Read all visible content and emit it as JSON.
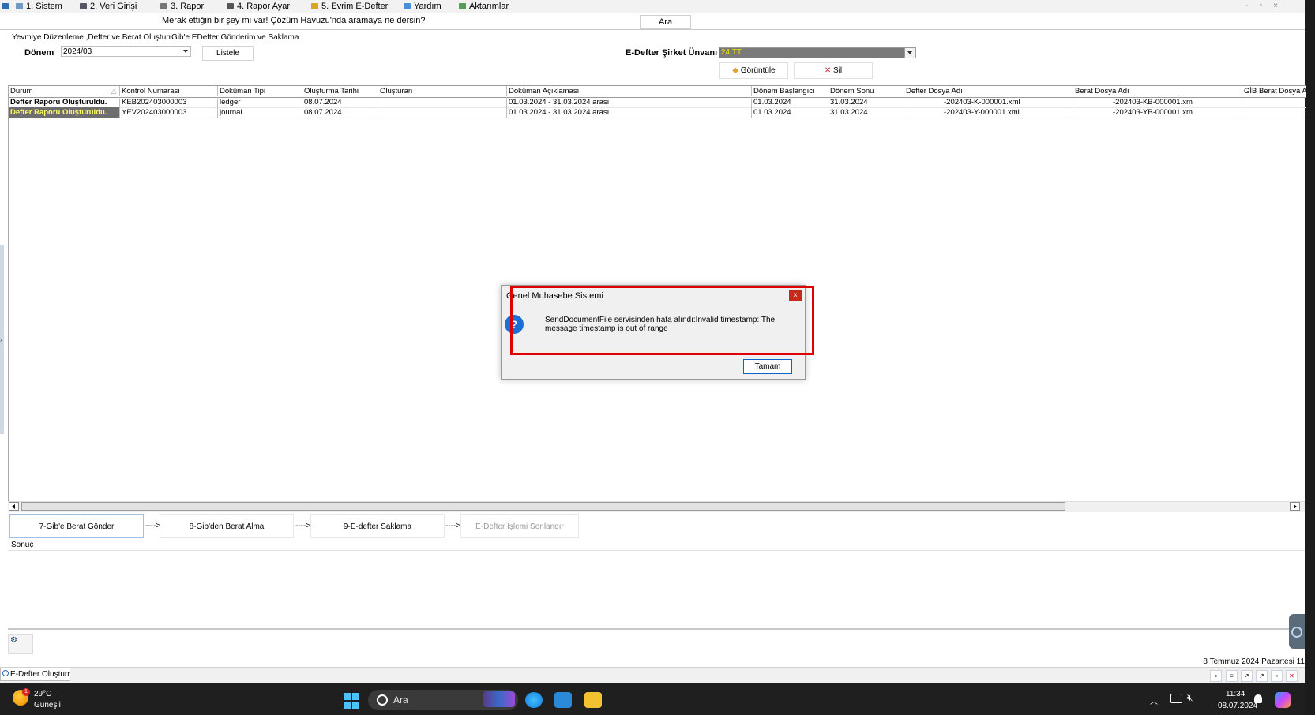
{
  "menu": {
    "items": [
      {
        "label": "1. Sistem"
      },
      {
        "label": "2.   Veri Girişi"
      },
      {
        "label": "3.   Rapor"
      },
      {
        "label": "4.   Rapor Ayar"
      },
      {
        "label": "5. Evrim E-Defter"
      },
      {
        "label": "Yardım"
      },
      {
        "label": "Aktarımlar"
      }
    ]
  },
  "search": {
    "prompt": "Merak ettiğin bir şey mi var! Çözüm Havuzu'nda aramaya ne dersin?",
    "button_label": "Ara"
  },
  "tabs": [
    {
      "label": "Yevmiye Düzenleme ,Defter ve Berat Oluşturma"
    },
    {
      "label": "Gib'e EDefter Gönderim ve Saklama"
    }
  ],
  "filters": {
    "donem_label": "Dönem",
    "donem_value": "2024/03",
    "listele_label": "Listele",
    "unvan_label": "E-Defter Şirket Ünvanı",
    "unvan_value": "24:TT",
    "goruntule_label": "Görüntüle",
    "sil_label": "Sil"
  },
  "grid": {
    "columns": [
      {
        "label": "Durum"
      },
      {
        "label": "Kontrol Numarası"
      },
      {
        "label": "Doküman Tipi"
      },
      {
        "label": "Oluşturma Tarihi"
      },
      {
        "label": "Oluşturan"
      },
      {
        "label": "Doküman Açıklaması"
      },
      {
        "label": "Dönem Başlangıcı"
      },
      {
        "label": "Dönem Sonu"
      },
      {
        "label": "Defter Dosya Adı"
      },
      {
        "label": "Berat Dosya Adı"
      },
      {
        "label": "GİB Berat Dosya A"
      }
    ],
    "rows": [
      {
        "durum": "Defter Raporu Oluşturuldu.",
        "kontrol": "KEB202403000003",
        "tip": "ledger",
        "tarih": "08.07.2024",
        "olusturan": "",
        "aciklama": "01.03.2024 - 31.03.2024 arası",
        "baslangic": "01.03.2024",
        "sonu": "31.03.2024",
        "defter_dosya": "-202403-K-000001.xml",
        "berat_dosya": "-202403-KB-000001.xm",
        "gib_berat": ""
      },
      {
        "durum": "Defter Raporu Oluşturuldu.",
        "kontrol": "YEV202403000003",
        "tip": "journal",
        "tarih": "08.07.2024",
        "olusturan": "",
        "aciklama": "01.03.2024 - 31.03.2024 arası",
        "baslangic": "01.03.2024",
        "sonu": "31.03.2024",
        "defter_dosya": "-202403-Y-000001.xml",
        "berat_dosya": "-202403-YB-000001.xm",
        "gib_berat": ""
      }
    ]
  },
  "steps": {
    "step7": "7-Gib'e Berat Gönder",
    "arrow": "---->",
    "step8": "8-Gib'den Berat Alma",
    "step9": "9-E-defter Saklama",
    "step_end": "E-Defter İşlemi Sonlandır"
  },
  "sonuc_label": "Sonuç",
  "dialog": {
    "title": "Genel Muhasebe Sistemi",
    "icon_glyph": "?",
    "close_glyph": "×",
    "message": "SendDocumentFile servisinden hata alındı:Invalid timestamp: The message timestamp is out of range",
    "ok_label": "Tamam"
  },
  "statusbar": {
    "date_text": "8 Temmuz 2024 Pazartesi 11",
    "doc_tab": "E-Defter Oluşturma"
  },
  "taskbar": {
    "weather_temp": "29°C",
    "weather_desc": "Güneşli",
    "weather_badge": "1",
    "search_text": "Ara",
    "clock_time": "11:34",
    "clock_date": "08.07.2024"
  },
  "colors": {
    "status_highlight_bg": "#6e6e6e",
    "status_highlight_text": "#ffff66",
    "annotation_red": "#e00000",
    "dialog_close_red": "#c42b1c",
    "taskbar_bg": "#1f1f1f"
  }
}
